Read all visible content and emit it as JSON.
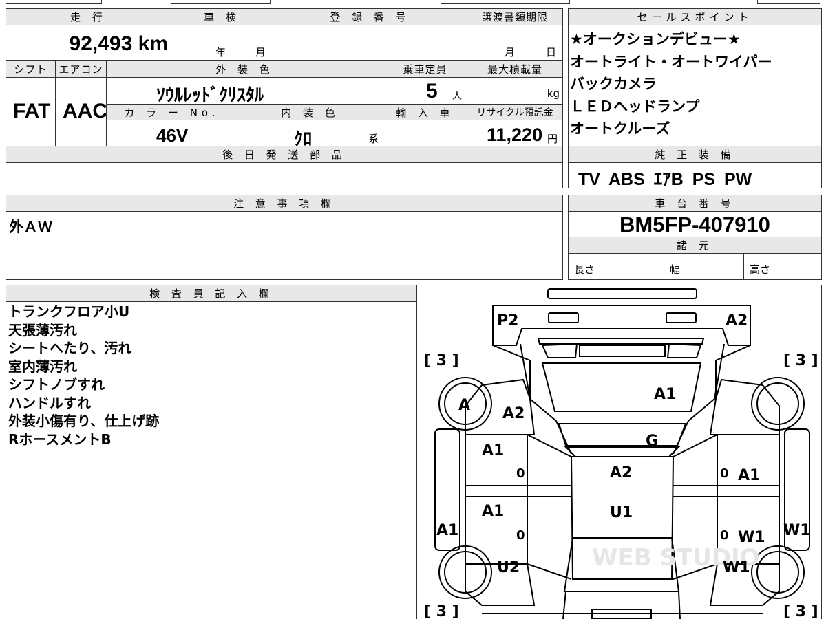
{
  "vehicle_info": {
    "mileage_label": "走 行",
    "mileage_value": "92,493 km",
    "inspection_label": "車 検",
    "inspection_year": "年",
    "inspection_month": "月",
    "registration_label": "登 録 番 号",
    "transfer_deadline_label": "譲渡書類期限",
    "transfer_month": "月",
    "transfer_day": "日",
    "shift_label": "シフト",
    "shift_value": "FAT",
    "aircon_label": "エアコン",
    "aircon_value": "AAC",
    "exterior_color_label": "外 装 色",
    "exterior_color_value": "ｿｳﾙﾚｯﾄﾞｸﾘｽﾀﾙ",
    "capacity_label": "乗車定員",
    "capacity_value": "5",
    "capacity_unit": "人",
    "max_load_label": "最大積載量",
    "max_load_unit": "kg",
    "color_no_label": "カ ラ ー No.",
    "color_no_value": "46V",
    "interior_color_label": "内 装 色",
    "interior_color_value": "ｸﾛ",
    "interior_color_suffix": "系",
    "import_label": "輸 入 車",
    "recycle_label": "リサイクル預託金",
    "recycle_value": "11,220",
    "recycle_unit": "円",
    "later_parts_label": "後 日 発 送 部 品"
  },
  "sales_points": {
    "header": "セールスポイント",
    "items": [
      "★オークションデビュー★",
      "オートライト・オートワイパー",
      "バックカメラ",
      "ＬＥＤヘッドランプ",
      "オートクルーズ"
    ]
  },
  "equipment": {
    "header": "純 正 装 備",
    "value": "TV ABS ｴｱB PS PW"
  },
  "notes": {
    "header": "注 意 事 項 欄",
    "value": "外ＡＷ"
  },
  "chassis": {
    "header": "車 台 番 号",
    "value": "BM5FP-407910",
    "specs_header": "諸 元",
    "length_label": "長さ",
    "width_label": "幅",
    "height_label": "高さ"
  },
  "inspector": {
    "header": "検 査 員 記 入 欄",
    "lines": [
      "トランクフロア小U",
      "天張薄汚れ",
      "シートへたり、汚れ",
      "室内薄汚れ",
      "シフトノブすれ",
      "ハンドルすれ",
      "外装小傷有り、仕上げ跡",
      "RホースメントB"
    ]
  },
  "diagram": {
    "tread_tl": "[ 3 ]",
    "tread_tr": "[ 3 ]",
    "tread_bl": "[ 3 ]",
    "tread_br": "[ 3 ]",
    "marks": {
      "p2": "P2",
      "a2_rear_right": "A2",
      "a_wheel": "A",
      "a2_left": "A2",
      "a1_glass": "A1",
      "g_glass": "G",
      "a1_left_door_front": "A1",
      "zero_1": "0",
      "a2_center": "A2",
      "zero_2": "0",
      "a1_right_door": "A1",
      "a1_left_door_rear": "A1",
      "zero_3": "0",
      "u1_center": "U1",
      "zero_4": "0",
      "w1_right_door": "W1",
      "a1_left_side": "A1",
      "w1_right_side": "W1",
      "u2": "U2",
      "w1_right_front": "W1"
    },
    "watermark": "WEB STUDIO"
  }
}
